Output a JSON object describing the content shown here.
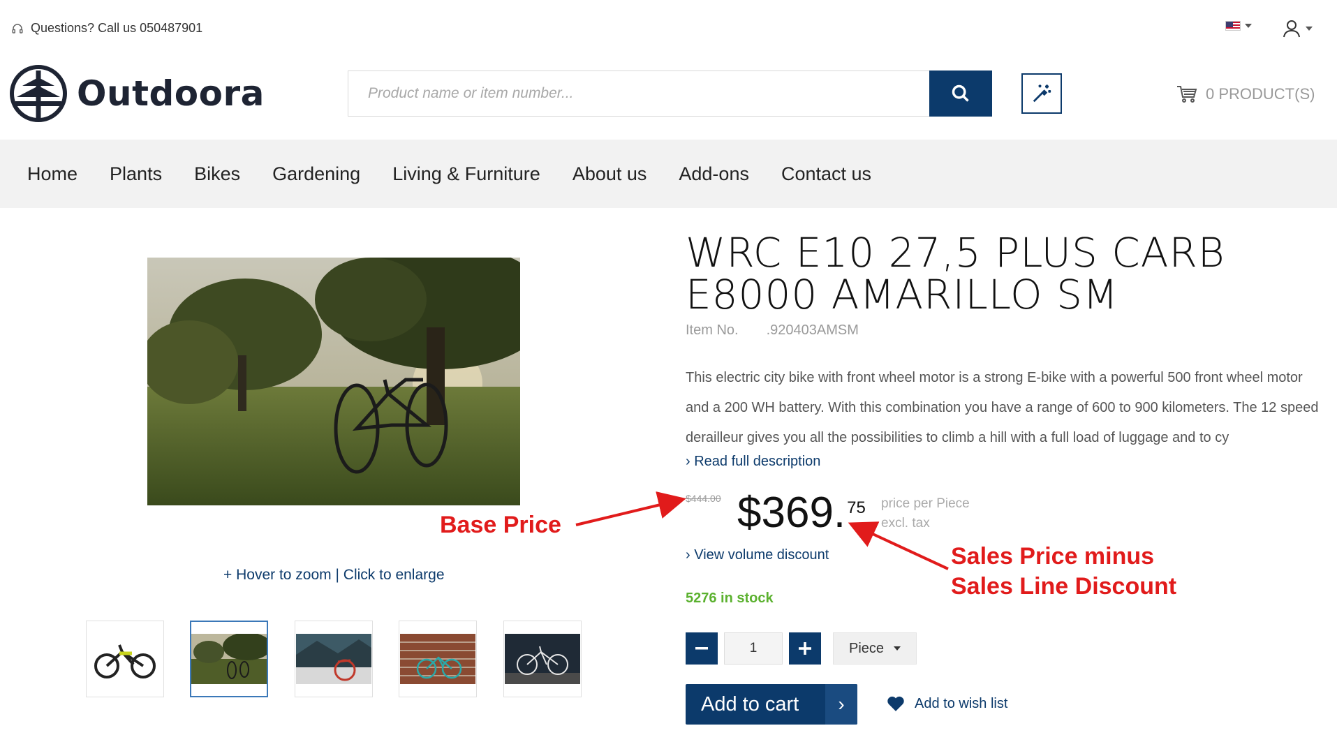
{
  "topbar": {
    "phone_text": "Questions? Call us 050487901"
  },
  "header": {
    "logo_text": "Outdoora",
    "search_placeholder": "Product name or item number...",
    "cart_text": "0 PRODUCT(S)"
  },
  "nav": {
    "items": [
      "Home",
      "Plants",
      "Bikes",
      "Gardening",
      "Living & Furniture",
      "About us",
      "Add-ons",
      "Contact us"
    ]
  },
  "gallery": {
    "zoom_hint": "+ Hover to zoom | Click to enlarge"
  },
  "product": {
    "title_line1": "WRC E10 27,5 PLUS CARB",
    "title_line2": "E8000 AMARILLO SM",
    "item_no_label": "Item No.",
    "item_no_value": ".920403AMSM",
    "description": "This electric city bike with front wheel motor is a strong E-bike with a powerful 500 front wheel motor and a 200 WH battery. With this combination you have a range of 600 to 900 kilometers. The 12 speed derailleur gives you all the possibilities to climb a hill with a full load of luggage and to cy",
    "read_more": "› Read full description",
    "base_price": "$444.00",
    "price_main": "$369.",
    "price_cents": "75",
    "price_note_1": "price per Piece",
    "price_note_2": "excl. tax",
    "volume_discount": "› View volume discount",
    "stock": "5276 in stock",
    "quantity": "1",
    "unit": "Piece",
    "add_to_cart": "Add to cart",
    "add_to_cart_chevron": "›",
    "wishlist": "Add to wish list"
  },
  "annotations": {
    "base_price": "Base Price",
    "sales_line1": "Sales Price minus",
    "sales_line2": "Sales Line Discount"
  },
  "colors": {
    "primary": "#0c3a6b",
    "stock_green": "#5bb12f",
    "annotation_red": "#e11b1b"
  }
}
